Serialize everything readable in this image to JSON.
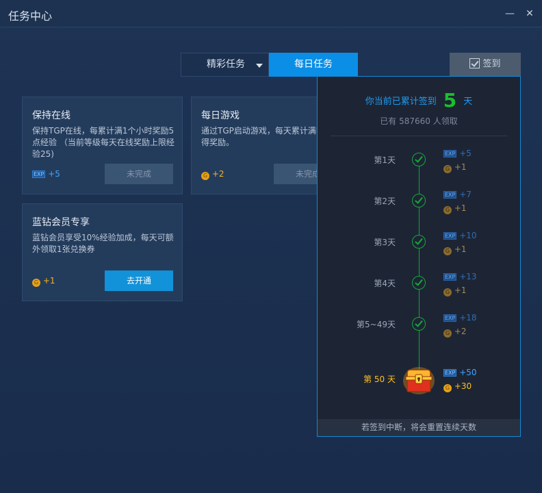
{
  "window": {
    "title": "任务中心",
    "minimize": "—",
    "close": "✕"
  },
  "tabs": {
    "featured": "精彩任务",
    "daily": "每日任务"
  },
  "sign_button": "签到",
  "cards": [
    {
      "title": "保持在线",
      "desc": "保持TGP在线，每累计满1个小时奖励5点经验 （当前等级每天在线奖励上限经验25)",
      "reward_type": "EXP",
      "reward": "+5",
      "button": "未完成"
    },
    {
      "title": "每日游戏",
      "desc": "通过TGP启动游戏，每天累计满时可获得奖励。",
      "reward_type": "coin",
      "reward": "+2",
      "button": "未完成"
    },
    {
      "title": "蓝钻会员专享",
      "desc": "蓝钻会员享受10%经验加成，每天可额外领取1张兑换券",
      "reward_type": "coin",
      "reward": "+1",
      "button": "去开通"
    }
  ],
  "signin": {
    "prefix": "你当前已累计签到",
    "count": "5",
    "suffix": "天",
    "claimed": "已有 587660 人领取",
    "exp_tag": "EXP",
    "coin_tag": "G",
    "days": [
      {
        "label": "第1天",
        "exp": "+5",
        "coin": "+1"
      },
      {
        "label": "第2天",
        "exp": "+7",
        "coin": "+1"
      },
      {
        "label": "第3天",
        "exp": "+10",
        "coin": "+1"
      },
      {
        "label": "第4天",
        "exp": "+13",
        "coin": "+1"
      },
      {
        "label": "第5~49天",
        "exp": "+18",
        "coin": "+2"
      },
      {
        "label": "第 50 天",
        "exp": "+50",
        "coin": "+30"
      }
    ],
    "footer": "若签到中断，将会重置连续天数"
  },
  "colors": {
    "accent": "#0b8ee6",
    "signed_green": "#16a83a",
    "gold": "#ffc01e"
  }
}
